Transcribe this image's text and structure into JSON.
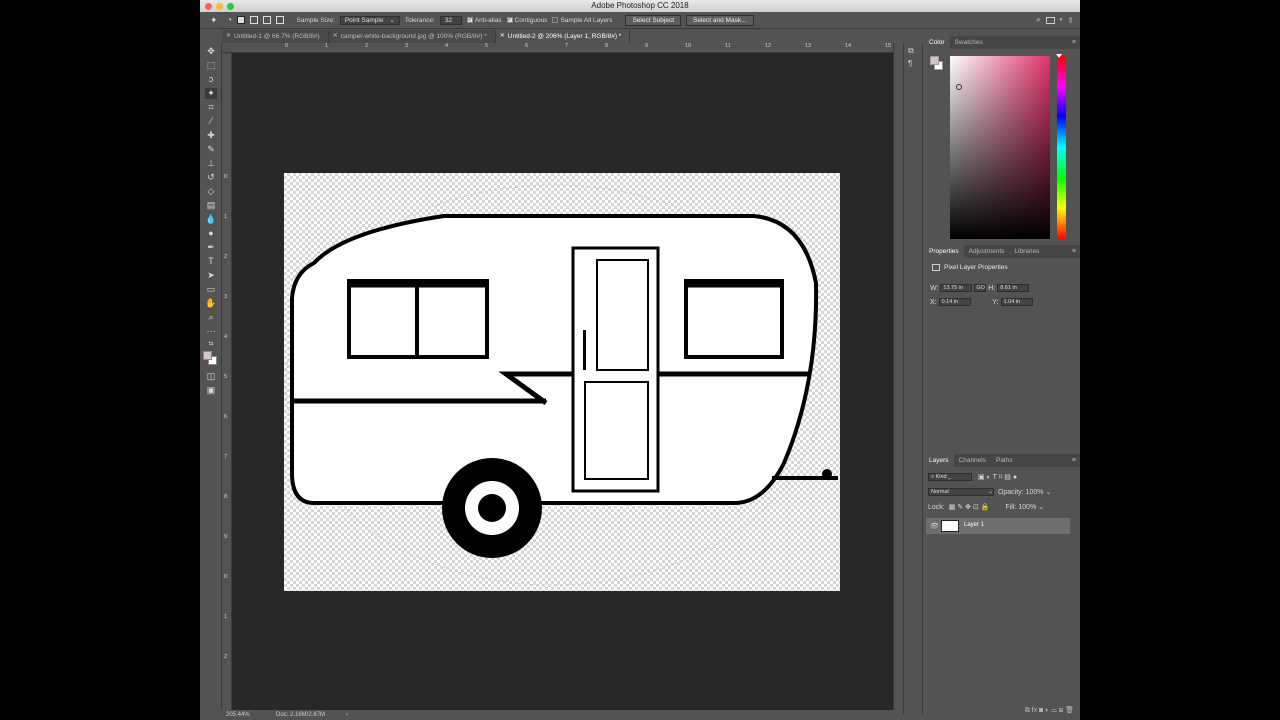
{
  "titlebar": {
    "title": "Adobe Photoshop CC 2018"
  },
  "options": {
    "sample_size_label": "Sample Size:",
    "sample_size_value": "Point Sample",
    "tolerance_label": "Tolerance:",
    "tolerance_value": "32",
    "anti_alias_label": "Anti-alias",
    "contiguous_label": "Contiguous",
    "sample_all_layers_label": "Sample All Layers",
    "select_subject_label": "Select Subject",
    "select_and_mask_label": "Select and Mask..."
  },
  "tabs": [
    {
      "label": "Untitled-1 @ 66.7% (RGB/8#)"
    },
    {
      "label": "camper-white-background.jpg @ 100% (RGB/8#) *"
    },
    {
      "label": "Untitled-2 @ 206% (Layer 1, RGB/8#) *"
    }
  ],
  "rulers": {
    "top": [
      "0",
      "1",
      "2",
      "3",
      "4",
      "5",
      "6",
      "7",
      "8",
      "9",
      "10",
      "11",
      "12",
      "13",
      "14",
      "15"
    ],
    "left": [
      "0",
      "1",
      "2",
      "3",
      "4",
      "5",
      "6",
      "7",
      "8",
      "9",
      "0",
      "1",
      "2"
    ]
  },
  "status": {
    "zoom": "205.44%",
    "doc": "Doc: 2.16M/2.87M"
  },
  "color_panel": {
    "tabs": [
      "Color",
      "Swatches"
    ],
    "foreground": "#d6c4cc",
    "background": "#ffffff",
    "hue_color": "#e0336a"
  },
  "properties_panel": {
    "tabs": [
      "Properties",
      "Adjustments",
      "Libraries"
    ],
    "header": "Pixel Layer Properties",
    "w_label": "W:",
    "w_value": "13.75 in",
    "h_label": "H:",
    "h_value": "8.61 in",
    "x_label": "X:",
    "x_value": "0.14 in",
    "y_label": "Y:",
    "y_value": "1.04 in",
    "link_label": "GO"
  },
  "layers_panel": {
    "tabs": [
      "Layers",
      "Channels",
      "Paths"
    ],
    "kind_label": "Kind",
    "blend_mode": "Normal",
    "opacity_label": "Opacity:",
    "opacity_value": "100%",
    "lock_label": "Lock:",
    "fill_label": "Fill:",
    "fill_value": "100%",
    "layers": [
      {
        "name": "Layer 1"
      }
    ]
  }
}
